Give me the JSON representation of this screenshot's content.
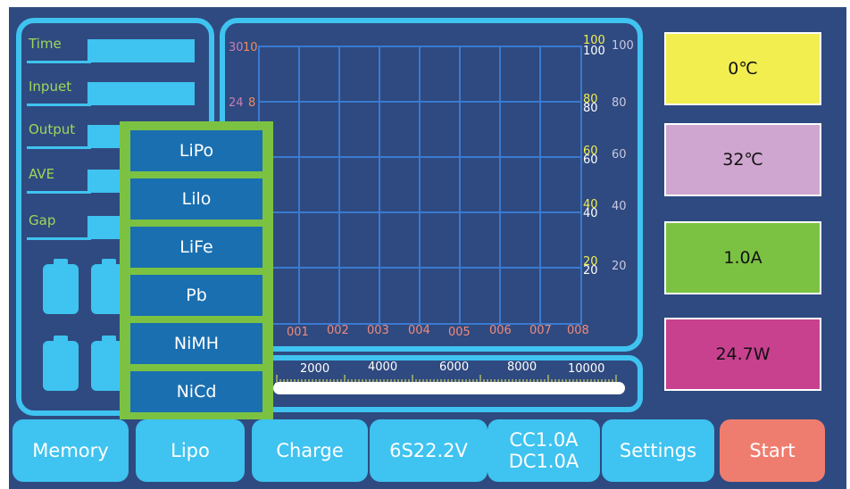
{
  "left_panel": {
    "labels": [
      "Time",
      "Inpuet",
      "Output",
      "AVE",
      "Gap"
    ]
  },
  "graph": {
    "left_outer_ticks": [
      "30",
      "24"
    ],
    "left_inner_ticks": [
      "10",
      "8"
    ],
    "right_yellow_ticks": [
      "100",
      "80",
      "60",
      "40",
      "20"
    ],
    "right_white_inner_ticks": [
      "100",
      "80",
      "60",
      "40",
      "20"
    ],
    "right_outer_ticks": [
      "100",
      "80",
      "60",
      "40",
      "20"
    ],
    "x_ticks": [
      "001",
      "002",
      "003",
      "004",
      "005",
      "006",
      "007",
      "008"
    ]
  },
  "scale": {
    "ticks": [
      "2000",
      "4000",
      "6000",
      "8000",
      "10000"
    ]
  },
  "stats": {
    "temp1": "0℃",
    "temp2": "32℃",
    "current": "1.0A",
    "power": "24.7W"
  },
  "battery_menu": {
    "options": [
      "LiPo",
      "Lilo",
      "LiFe",
      "Pb",
      "NiMH",
      "NiCd"
    ]
  },
  "bottom": {
    "memory": "Memory",
    "lipo": "Lipo",
    "charge": "Charge",
    "voltage": "6S22.2V",
    "cc": "CC1.0A",
    "dc": "DC1.0A",
    "settings": "Settings",
    "start": "Start"
  },
  "colors": {
    "background": "#2f4a80",
    "accent": "#3fc3f0",
    "menu_frame": "#7cc242",
    "menu_option": "#1a6fb0",
    "stat_temp1": "#f2ee50",
    "stat_temp2": "#cfa6d0",
    "stat_current": "#7cc242",
    "stat_power": "#c8418f",
    "start_button": "#ef7d6f"
  }
}
